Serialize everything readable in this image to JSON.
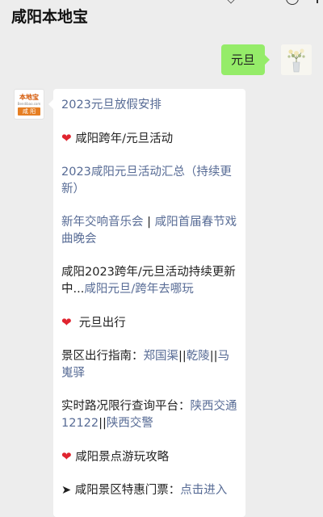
{
  "header": {
    "title": "咸阳本地宝"
  },
  "outgoing": {
    "text": "元旦"
  },
  "account": {
    "logo_text": "本地宝",
    "logo_sub": "Bendibao.com",
    "logo_city": "咸 阳"
  },
  "message": {
    "item1": "2023元旦放假安排",
    "section1": "咸阳跨年/元旦活动",
    "item2": "2023咸阳元旦活动汇总（持续更新）",
    "item3a": "新年交响音乐会",
    "item3sep": " | ",
    "item3b": "咸阳首届春节戏曲晚会",
    "item4a": "咸阳2023跨年/元旦活动持续更新中...",
    "item4b": "咸阳元旦/跨年去哪玩",
    "section2": "元旦出行",
    "item5a": "景区出行指南：",
    "item5b": "郑国渠",
    "item5sep1": "||",
    "item5c": "乾陵",
    "item5sep2": "||",
    "item5d": "马嵬驿",
    "item6a": "实时路况限行查询平台：",
    "item6b": "陕西交通12122",
    "item6sep": "||",
    "item6c": "陕西交警",
    "section3": "咸阳景点游玩攻略",
    "item7a": "➤ 咸阳景区特惠门票：",
    "item7b": "点击进入"
  }
}
